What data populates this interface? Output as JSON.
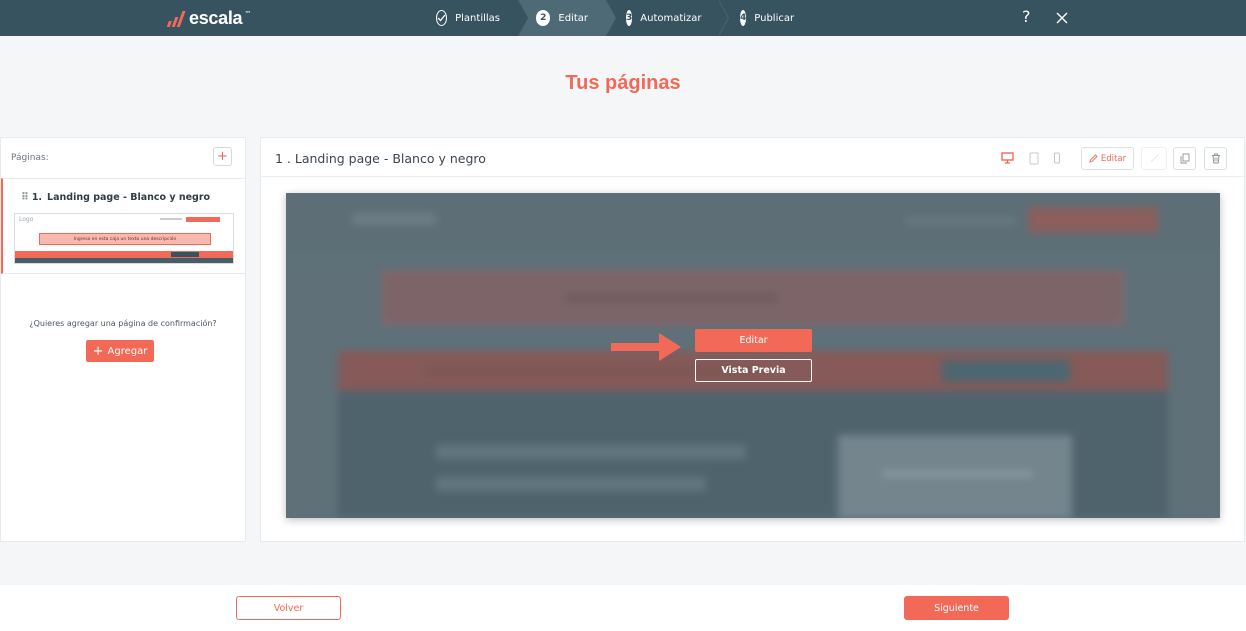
{
  "brand": {
    "name": "escala",
    "tm": "™",
    "accent": "#f26a57",
    "topbar_bg": "#37535f"
  },
  "steps": [
    {
      "label": "Plantillas",
      "state": "done",
      "icon": "check-icon"
    },
    {
      "label": "Editar",
      "number": "2",
      "state": "active"
    },
    {
      "label": "Automatizar",
      "number": "3",
      "state": "pending"
    },
    {
      "label": "Publicar",
      "number": "4",
      "state": "pending"
    }
  ],
  "header": {
    "help": "?",
    "close_icon": "close-icon"
  },
  "title": "Tus páginas",
  "sidebar": {
    "pages_label": "Páginas:",
    "add_symbol": "+",
    "page_item": {
      "number": "1.",
      "name": "Landing page - Blanco y negro",
      "thumb_logo": "Logo",
      "thumb_desc": "Ingresa en esta caja un texto una descripción"
    },
    "confirm_question": "¿Quieres agregar una página de confirmación?",
    "add_button": "Agregar",
    "add_button_symbol": "+"
  },
  "main": {
    "title": "1 . Landing page - Blanco y negro",
    "edit_tool": "Editar",
    "devices": [
      "desktop-icon",
      "tablet-icon",
      "mobile-icon"
    ],
    "overlay_edit": "Editar",
    "overlay_preview": "Vista Previa"
  },
  "footer": {
    "back": "Volver",
    "next": "Siguiente"
  }
}
